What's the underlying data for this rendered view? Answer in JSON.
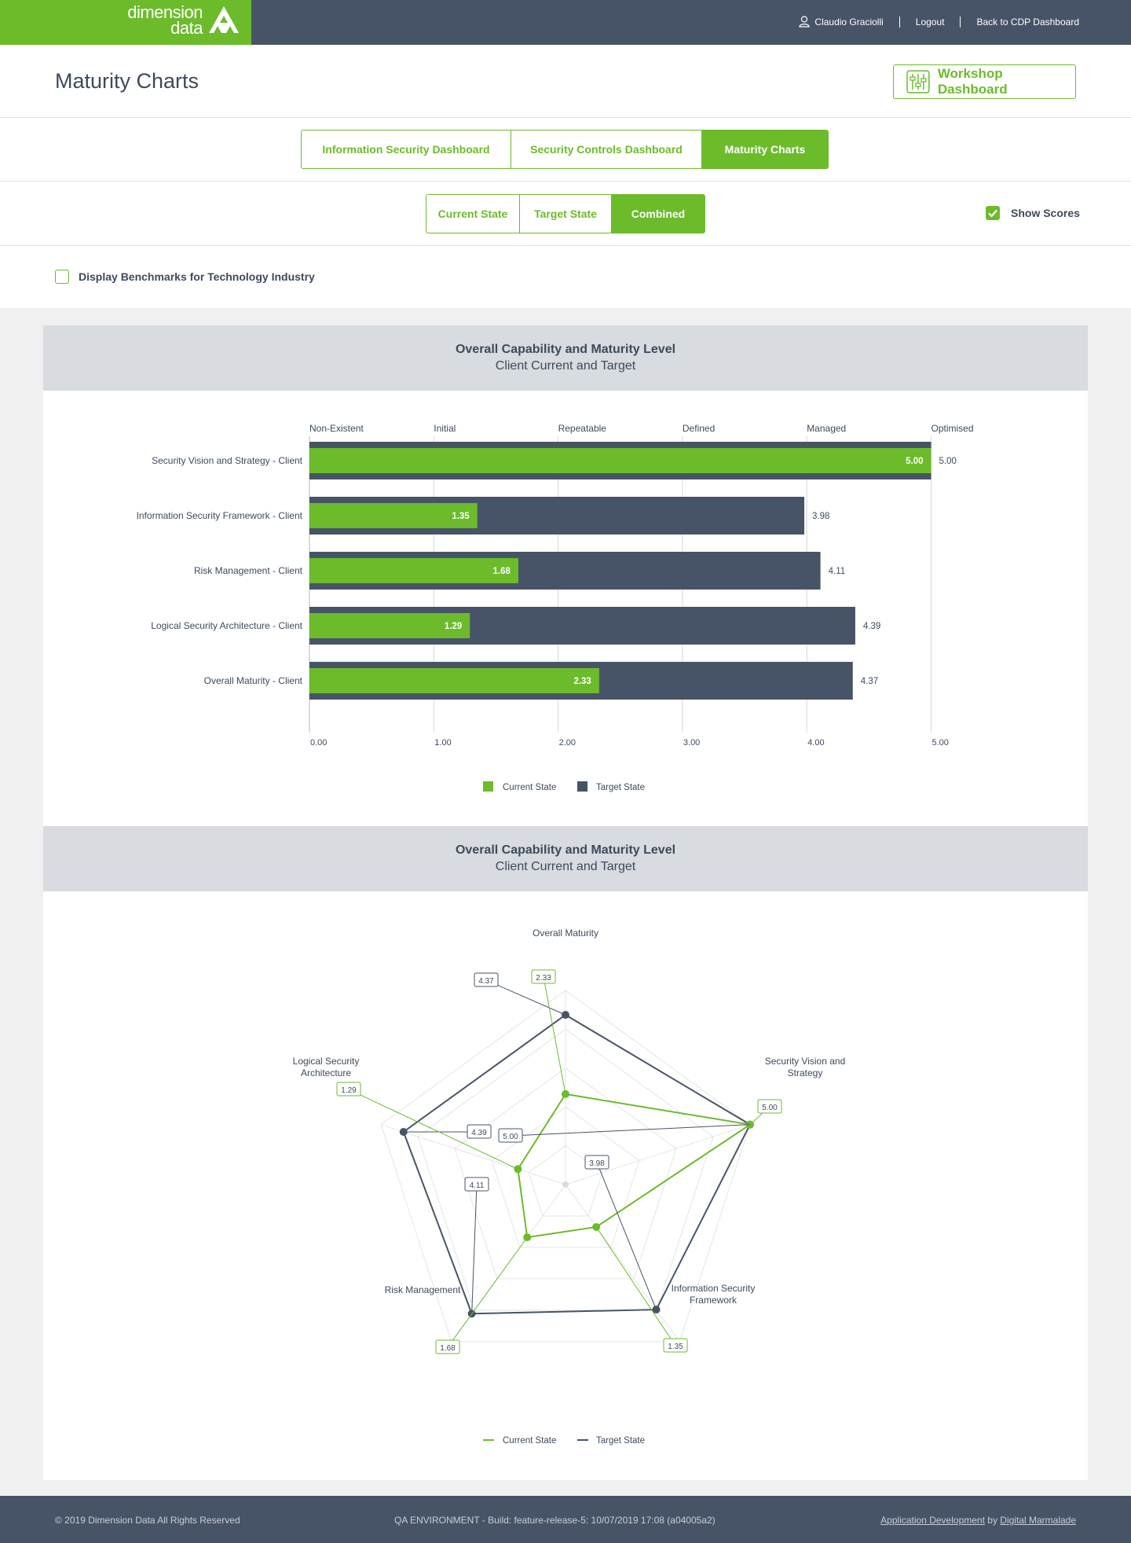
{
  "brand": {
    "logo_line1": "dimension",
    "logo_line2": "data"
  },
  "header": {
    "user_name": "Claudio Graciolli",
    "logout": "Logout",
    "back_link": "Back to CDP Dashboard"
  },
  "page": {
    "title": "Maturity Charts",
    "workshop_button": "Workshop Dashboard"
  },
  "main_tabs": [
    {
      "label": "Information Security Dashboard",
      "active": false
    },
    {
      "label": "Security Controls Dashboard",
      "active": false
    },
    {
      "label": "Maturity Charts",
      "active": true
    }
  ],
  "state_tabs": [
    {
      "label": "Current State",
      "active": false
    },
    {
      "label": "Target State",
      "active": false
    },
    {
      "label": "Combined",
      "active": true
    }
  ],
  "show_scores": {
    "label": "Show Scores",
    "checked": true
  },
  "benchmark": {
    "label": "Display Benchmarks for Technology Industry",
    "checked": false
  },
  "colors": {
    "current": "#6cbb2b",
    "target": "#475467"
  },
  "bar_panel": {
    "title": "Overall Capability and Maturity Level",
    "subtitle": "Client Current and Target"
  },
  "radar_panel": {
    "title": "Overall Capability and Maturity Level",
    "subtitle": "Client Current and Target"
  },
  "legend": {
    "current": "Current State",
    "target": "Target State"
  },
  "chart_data": [
    {
      "type": "bar",
      "title": "Overall Capability and Maturity Level",
      "subtitle": "Client Current and Target",
      "orientation": "horizontal",
      "categories": [
        "Security Vision and Strategy - Client",
        "Information Security Framework - Client",
        "Risk Management - Client",
        "Logical Security Architecture - Client",
        "Overall Maturity - Client"
      ],
      "series": [
        {
          "name": "Current State",
          "values": [
            5.0,
            1.35,
            1.68,
            1.29,
            2.33
          ]
        },
        {
          "name": "Target State",
          "values": [
            5.0,
            3.98,
            4.11,
            4.39,
            4.37
          ]
        }
      ],
      "value_labels_current": [
        "5.00",
        "1.35",
        "1.68",
        "1.29",
        "2.33"
      ],
      "value_labels_target": [
        "5.00",
        "3.98",
        "4.11",
        "4.39",
        "4.37"
      ],
      "top_axis_labels": [
        "Non-Existent",
        "Initial",
        "Repeatable",
        "Defined",
        "Managed",
        "Optimised"
      ],
      "x_ticks": [
        "0.00",
        "1.00",
        "2.00",
        "3.00",
        "4.00",
        "5.00"
      ],
      "xlim": [
        0,
        5
      ],
      "grid": true,
      "legend": "bottom"
    },
    {
      "type": "radar",
      "title": "Overall Capability and Maturity Level",
      "subtitle": "Client Current and Target",
      "axes": [
        "Overall Maturity",
        "Security Vision and Strategy",
        "Information Security Framework",
        "Risk Management",
        "Logical Security Architecture"
      ],
      "axis_label_lines": [
        [
          "Overall Maturity"
        ],
        [
          "Security Vision and",
          "Strategy"
        ],
        [
          "Information Security",
          "Framework"
        ],
        [
          "Risk Management"
        ],
        [
          "Logical Security",
          "Architecture"
        ]
      ],
      "series": [
        {
          "name": "Current State",
          "values": [
            2.33,
            5.0,
            1.35,
            1.68,
            1.29
          ],
          "labels": [
            "2.33",
            "5.00",
            "1.35",
            "1.68",
            "1.29"
          ]
        },
        {
          "name": "Target State",
          "values": [
            4.37,
            5.0,
            3.98,
            4.11,
            4.39
          ],
          "labels": [
            "4.37",
            "5.00",
            "3.98",
            "4.11",
            "4.39"
          ]
        }
      ],
      "rlim": [
        0,
        5
      ],
      "legend": "bottom"
    }
  ],
  "footer": {
    "copyright": "© 2019 Dimension Data All Rights Reserved",
    "build": "QA ENVIRONMENT - Build: feature-release-5: 10/07/2019 17:08 (a04005a2)",
    "credit_link": "Application Development",
    "credit_by": "by",
    "credit_company": "Digital Marmalade"
  }
}
